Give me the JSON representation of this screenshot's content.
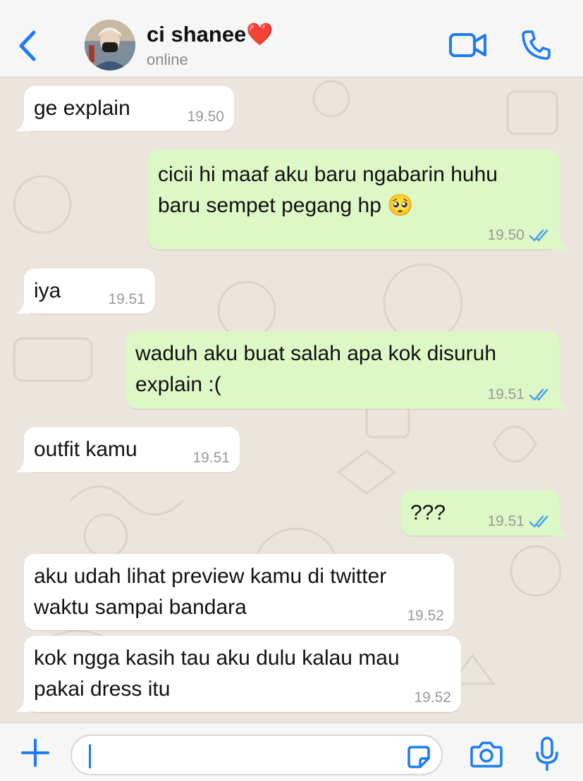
{
  "header": {
    "contact_name": "ci shanee❤️",
    "status": "online"
  },
  "colors": {
    "accent": "#1d7bf6",
    "incoming_bubble": "#ffffff",
    "outgoing_bubble": "#dcf8c6",
    "chat_background": "#ece5dd",
    "read_ticks": "#4fa3e6"
  },
  "icons": {
    "back": "chevron-left-icon",
    "video": "video-camera-icon",
    "call": "phone-icon",
    "attach": "plus-icon",
    "sticker": "sticker-icon",
    "camera": "camera-icon",
    "mic": "microphone-icon",
    "read": "double-check-icon"
  },
  "messages": [
    {
      "dir": "in",
      "text": "ge explain",
      "time": "19.50"
    },
    {
      "dir": "out",
      "text": "cicii hi maaf aku baru ngabarin huhu\nbaru sempet pegang hp 🥺",
      "time": "19.50",
      "read": true
    },
    {
      "dir": "in",
      "text": "iya",
      "time": "19.51"
    },
    {
      "dir": "out",
      "text": "waduh aku buat salah apa kok disuruh\nexplain :(",
      "time": "19.51",
      "read": true
    },
    {
      "dir": "in",
      "text": "outfit kamu",
      "time": "19.51"
    },
    {
      "dir": "out",
      "text": "???",
      "time": "19.51",
      "read": true
    },
    {
      "dir": "in",
      "text": "aku udah lihat preview kamu di twitter\nwaktu sampai bandara",
      "time": "19.52"
    },
    {
      "dir": "in",
      "text": "kok ngga kasih tau aku dulu kalau mau\npakai dress itu",
      "time": "19.52"
    }
  ],
  "composer": {
    "value": ""
  }
}
